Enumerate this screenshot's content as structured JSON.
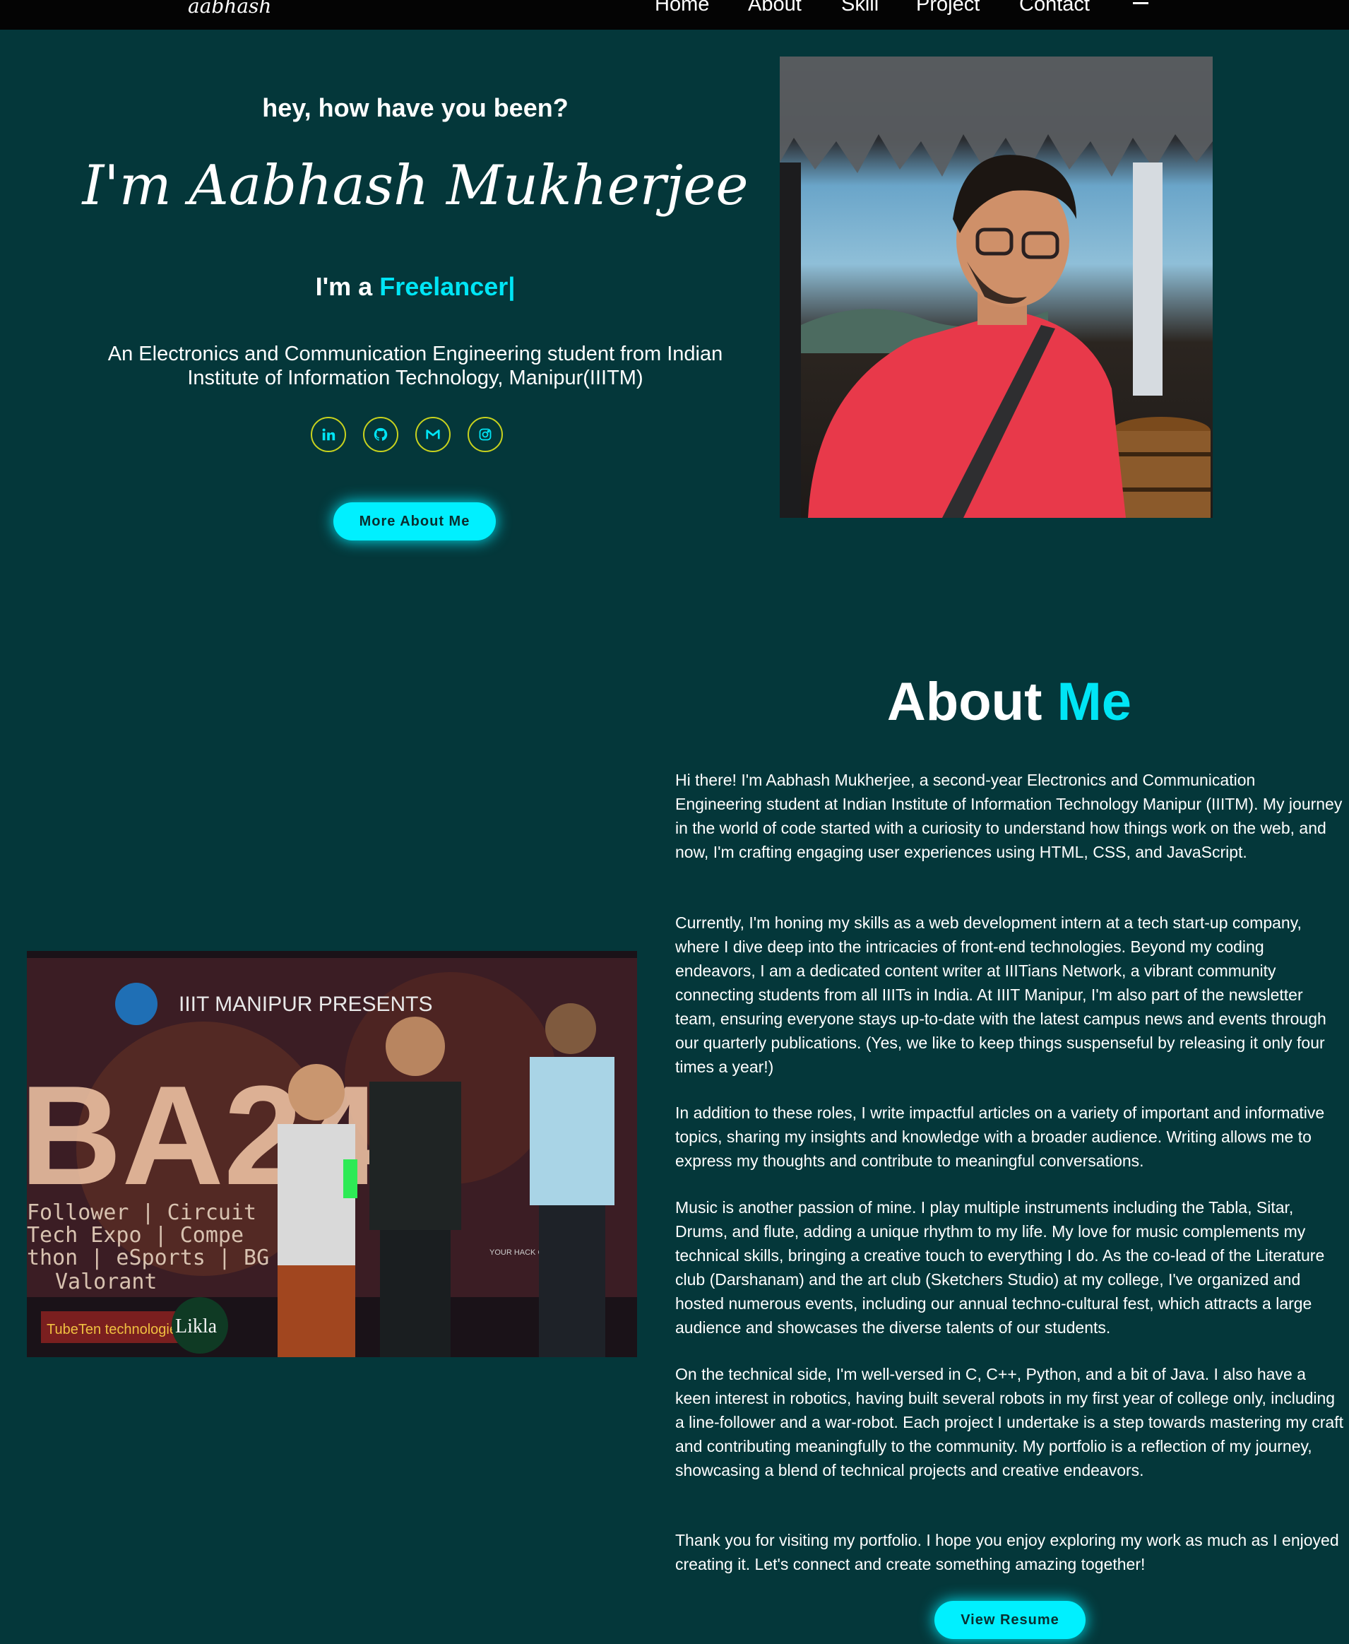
{
  "nav": {
    "logo": "aabhash",
    "links": [
      "Home",
      "About",
      "Skill",
      "Project",
      "Contact"
    ]
  },
  "hero": {
    "greeting": "hey, how have you been?",
    "name": "I'm Aabhash Mukherjee",
    "role_prefix": "I'm a ",
    "role_word": "Freelancer",
    "cursor": "|",
    "intro": "An Electronics and Communication Engineering student from Indian Institute of Information Technology, Manipur(IIITM)",
    "socials": [
      "linkedin-icon",
      "github-icon",
      "gmail-icon",
      "instagram-icon"
    ],
    "more_button": "More About Me"
  },
  "award_photo": {
    "banner_title": "IIIT MANIPUR PRESENTS",
    "event_text": "BA24",
    "events": [
      "Follower | Circuit",
      "Tech Expo | Compe",
      "thon | eSports | BG",
      "Valorant"
    ],
    "sponsor_left": "TubeTen technologies",
    "sponsor_right": "Likla",
    "hack_text": "YOUR HACK CYBERSECU"
  },
  "about": {
    "title_main": "About ",
    "title_highlight": "Me",
    "paragraphs": [
      "Hi there! I'm Aabhash Mukherjee, a second-year Electronics and Communication Engineering student at Indian Institute of Information Technology Manipur (IIITM). My journey in the world of code started with a curiosity to understand how things work on the web, and now, I'm crafting engaging user experiences using HTML, CSS, and JavaScript.",
      "Currently, I'm honing my skills as a web development intern at a tech start-up company, where I dive deep into the intricacies of front-end technologies. Beyond my coding endeavors, I am a dedicated content writer at IIITians Network, a vibrant community connecting students from all IIITs in India. At IIIT Manipur, I'm also part of the newsletter team, ensuring everyone stays up-to-date with the latest campus news and events through our quarterly publications. (Yes, we like to keep things suspenseful by releasing it only four times a year!)",
      "In addition to these roles, I write impactful articles on a variety of important and informative topics, sharing my insights and knowledge with a broader audience. Writing allows me to express my thoughts and contribute to meaningful conversations.",
      "Music is another passion of mine. I play multiple instruments including the Tabla, Sitar, Drums, and flute, adding a unique rhythm to my life. My love for music complements my technical skills, bringing a creative touch to everything I do. As the co-lead of the Literature club (Darshanam) and the art club (Sketchers Studio) at my college, I've organized and hosted numerous events, including our annual techno-cultural fest, which attracts a large audience and showcases the diverse talents of our students.",
      "On the technical side, I'm well-versed in C, C++, Python, and a bit of Java. I also have a keen interest in robotics, having built several robots in my first year of college only, including a line-follower and a war-robot. Each project I undertake is a step towards mastering my craft and contributing meaningfully to the community. My portfolio is a reflection of my journey, showcasing a blend of technical projects and creative endeavors.",
      "Thank you for visiting my portfolio. I hope you enjoy exploring my work as much as I enjoyed creating it. Let's connect and create something amazing together!"
    ],
    "resume_button": "View Resume"
  },
  "colors": {
    "background": "#04373a",
    "navbar": "#040404",
    "accent": "#00e5f5",
    "social_border": "#c8d21e"
  }
}
